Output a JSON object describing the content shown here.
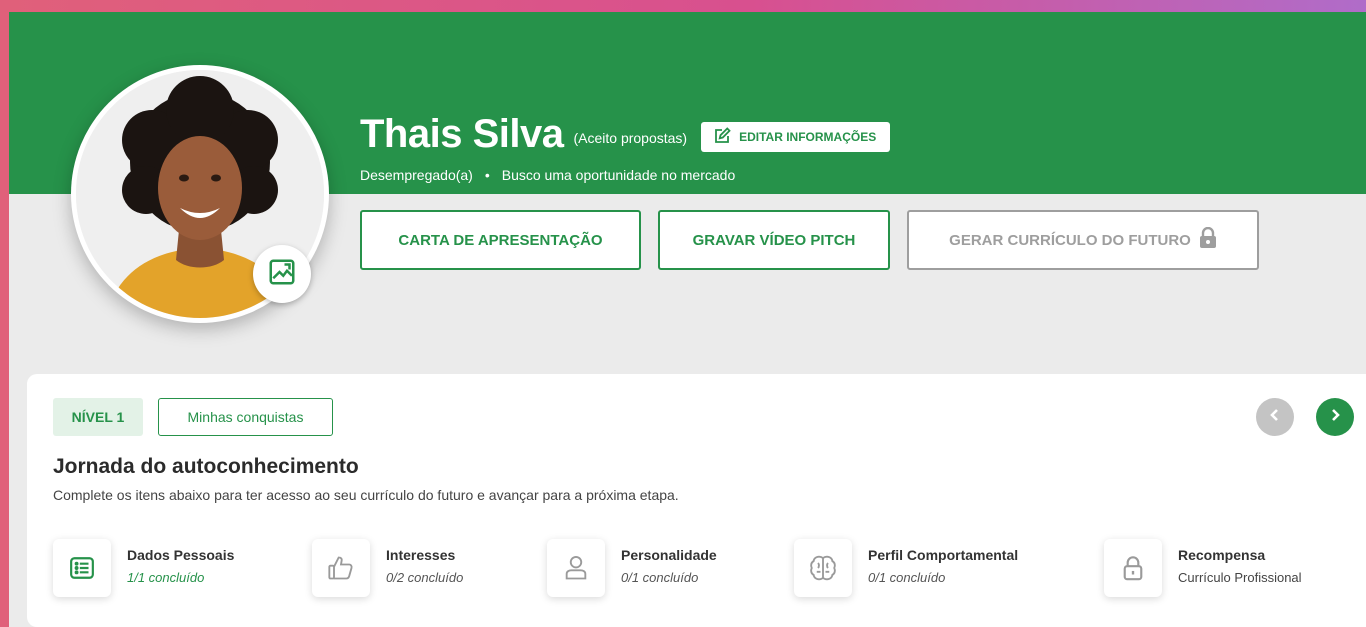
{
  "profile": {
    "name": "Thais Silva",
    "availability": "(Aceito propostas)",
    "edit_label": "EDITAR INFORMAÇÕES",
    "employment_status": "Desempregado(a)",
    "separator": "•",
    "goal": "Busco uma oportunidade no mercado"
  },
  "actions": {
    "cover_letter": "CARTA DE APRESENTAÇÃO",
    "video_pitch": "GRAVAR VÍDEO PITCH",
    "future_resume": "GERAR CURRÍCULO DO FUTURO"
  },
  "journey": {
    "level": "NÍVEL 1",
    "achievements": "Minhas conquistas",
    "title": "Jornada do autoconhecimento",
    "description": "Complete os itens abaixo para ter acesso ao seu currículo do futuro e avançar para a próxima etapa.",
    "steps": [
      {
        "title": "Dados Pessoais",
        "status": "1/1 concluído",
        "icon": "list-icon",
        "complete": true
      },
      {
        "title": "Interesses",
        "status": "0/2 concluído",
        "icon": "thumbs-up-icon",
        "complete": false
      },
      {
        "title": "Personalidade",
        "status": "0/1 concluído",
        "icon": "user-icon",
        "complete": false
      },
      {
        "title": "Perfil Comportamental",
        "status": "0/1 concluído",
        "icon": "brain-icon",
        "complete": false
      },
      {
        "title": "Recompensa",
        "status": "Currículo Profissional",
        "icon": "lock-icon",
        "complete": false
      }
    ]
  },
  "colors": {
    "brand_green": "#26924a",
    "disabled_gray": "#9e9e9e",
    "page_background": "#ebebeb"
  }
}
